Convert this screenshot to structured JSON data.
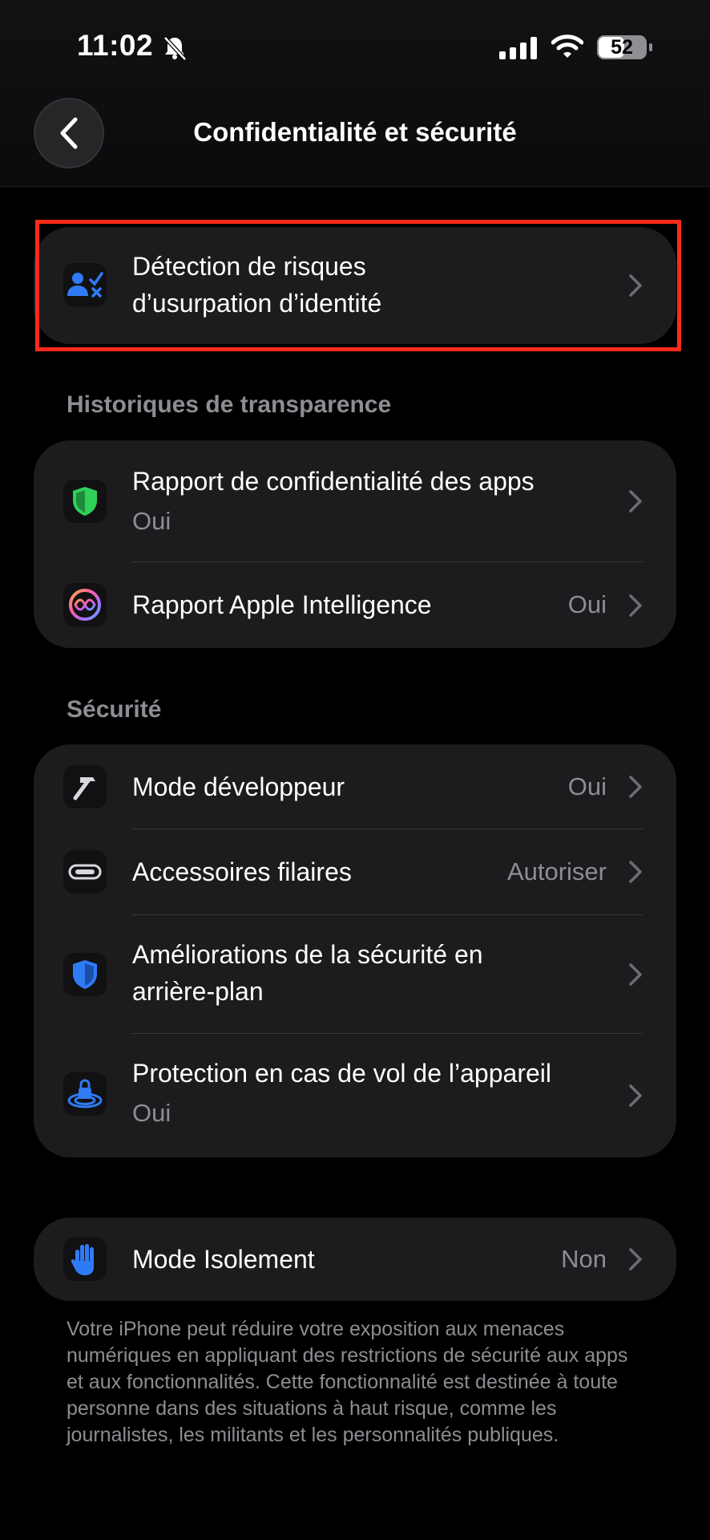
{
  "status_bar": {
    "time": "11:02",
    "battery": "52"
  },
  "nav": {
    "title": "Confidentialité et sécurité"
  },
  "identity_row": {
    "label_line1": "Détection de risques",
    "label_line2": "d’usurpation d’identité"
  },
  "sections": {
    "transparency": {
      "header": "Historiques de transparence",
      "rows": [
        {
          "label": "Rapport de confidentialité des apps",
          "sub": "Oui"
        },
        {
          "label": "Rapport Apple Intelligence",
          "value": "Oui"
        }
      ]
    },
    "security": {
      "header": "Sécurité",
      "rows": [
        {
          "label": "Mode développeur",
          "value": "Oui"
        },
        {
          "label": "Accessoires filaires",
          "value": "Autoriser"
        },
        {
          "label_line1": "Améliorations de la sécurité en",
          "label_line2": "arrière-plan"
        },
        {
          "label": "Protection en cas de vol de l’appareil",
          "sub": "Oui"
        }
      ]
    },
    "lockdown": {
      "label": "Mode Isolement",
      "value": "Non",
      "footer": "Votre iPhone peut réduire votre exposition aux menaces numériques en appliquant des restrictions de sécurité aux apps et aux fonctionnalités. Cette fonctionnalité est destinée à toute personne dans des situations à haut risque, comme les journalistes, les militants et les personnalités publiques."
    }
  },
  "colors": {
    "accent_blue": "#2f7bf6",
    "green": "#30d158",
    "highlight": "#ff2a1a"
  }
}
